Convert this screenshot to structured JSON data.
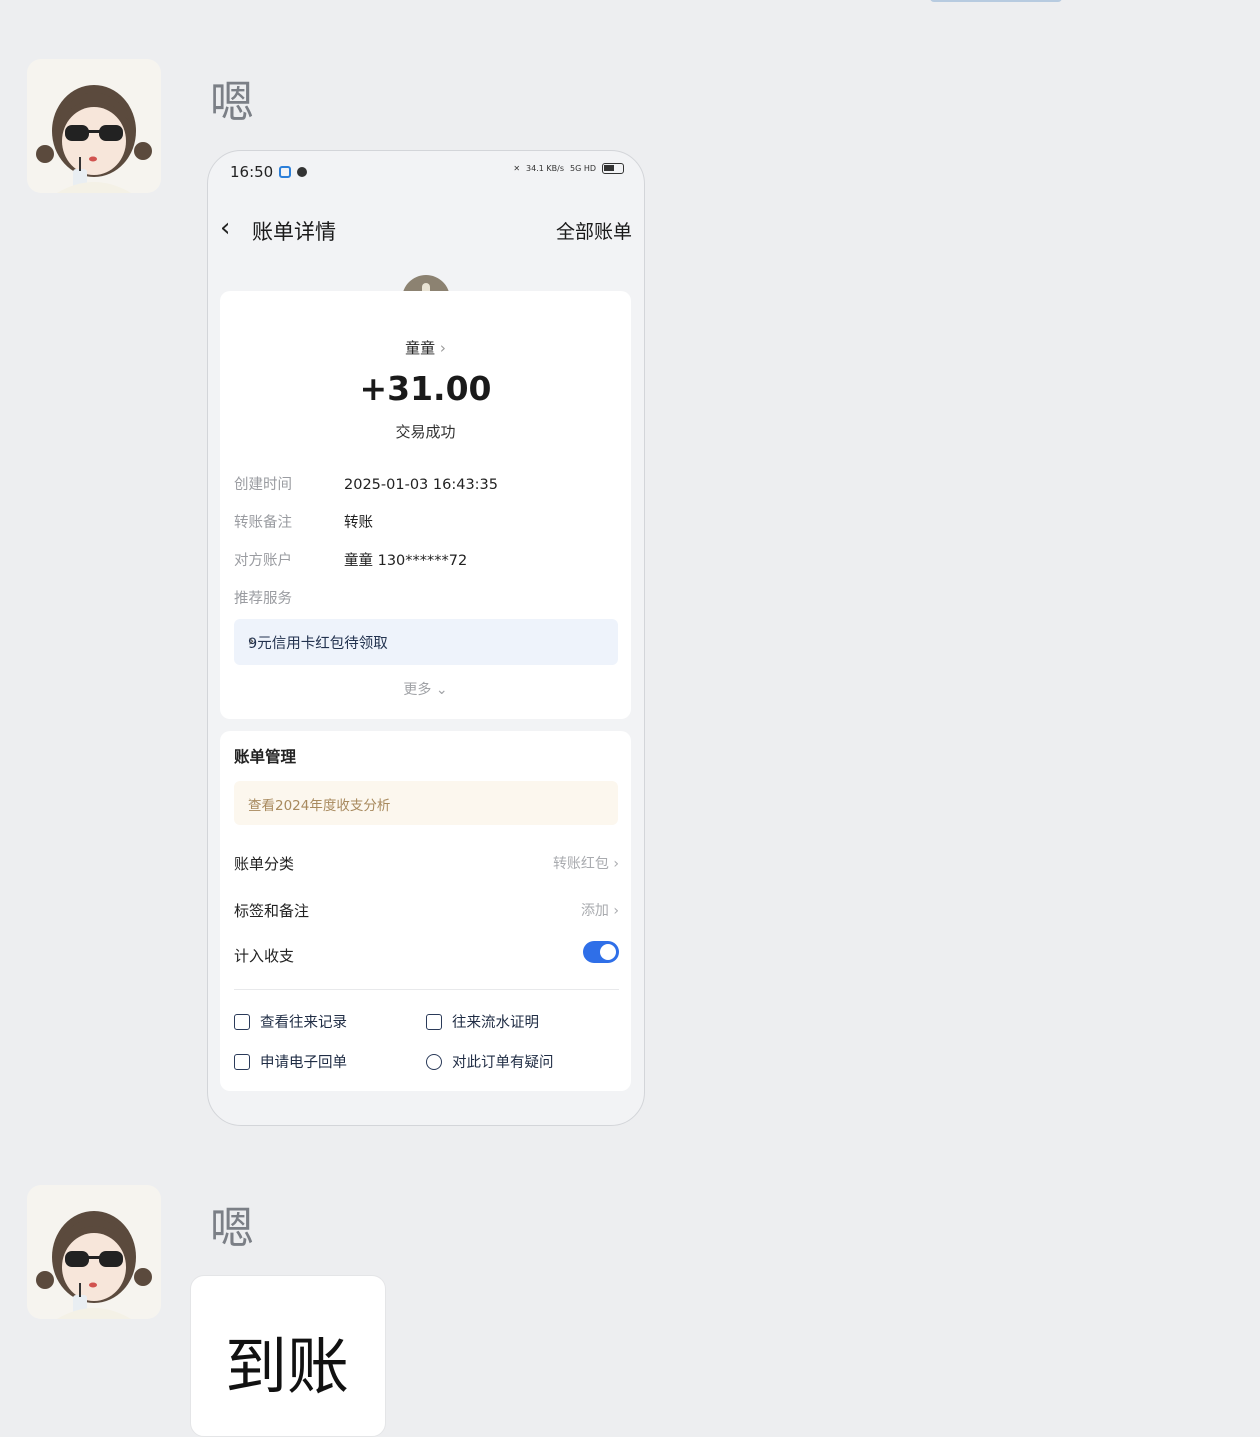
{
  "chat": {
    "messages": [
      {
        "sender": "嗯",
        "type": "image"
      },
      {
        "sender": "嗯",
        "type": "text",
        "text": "到账"
      }
    ]
  },
  "receipt": {
    "status_bar": {
      "time": "16:50",
      "speed": "34.1 KB/s",
      "network": "5G HD",
      "battery": "53"
    },
    "nav": {
      "title": "账单详情",
      "all_bills": "全部账单"
    },
    "payer_name": "童童",
    "amount": "+31.00",
    "state": "交易成功",
    "details": [
      {
        "key": "创建时间",
        "value": "2025-01-03 16:43:35"
      },
      {
        "key": "转账备注",
        "value": "转账"
      },
      {
        "key": "对方账户",
        "value": "童童 130******72"
      },
      {
        "key": "推荐服务",
        "value": ""
      }
    ],
    "promo": "9元信用卡红包待领取",
    "more": "更多",
    "manage": {
      "title": "账单管理",
      "annual": "查看2024年度收支分析",
      "rows": [
        {
          "label": "账单分类",
          "value": "转账红包"
        },
        {
          "label": "标签和备注",
          "value": "添加"
        },
        {
          "label": "计入收支",
          "value": ""
        }
      ],
      "toggle_on": true,
      "actions": [
        "查看往来记录",
        "往来流水证明",
        "申请电子回单",
        "对此订单有疑问"
      ]
    }
  },
  "colors": {
    "accent": "#2f6fe8",
    "background": "#edeef0"
  }
}
